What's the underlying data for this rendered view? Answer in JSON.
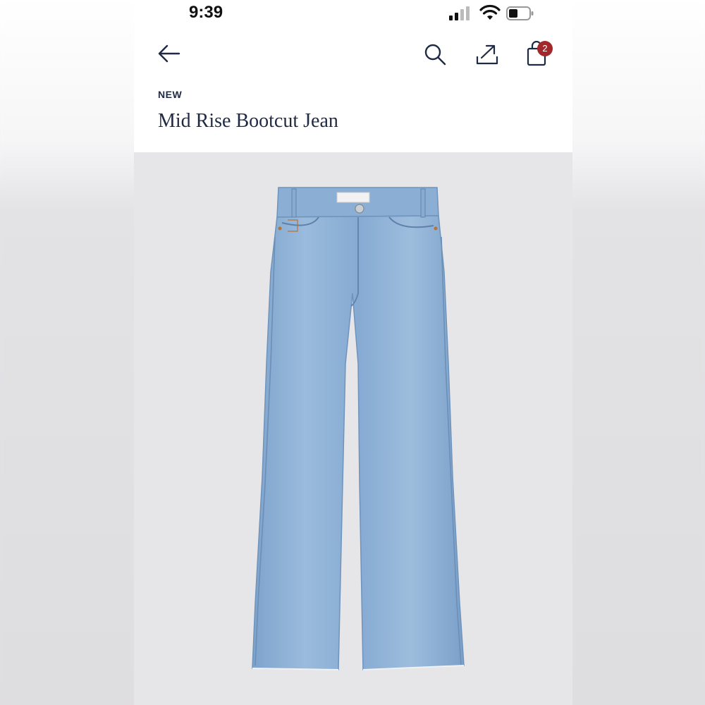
{
  "status_bar": {
    "time": "9:39"
  },
  "nav": {
    "back_icon": "arrow-left-icon",
    "search_icon": "search-icon",
    "share_icon": "share-icon",
    "bag_icon": "shopping-bag-icon",
    "bag_count": "2"
  },
  "product": {
    "tag": "NEW",
    "title": "Mid Rise Bootcut Jean",
    "image": "light-wash-bootcut-jeans-photo"
  },
  "colors": {
    "title_text": "#1f2a44",
    "badge": "#a3282c",
    "image_background": "#e6e5e8",
    "denim": "#8fb2d6"
  }
}
